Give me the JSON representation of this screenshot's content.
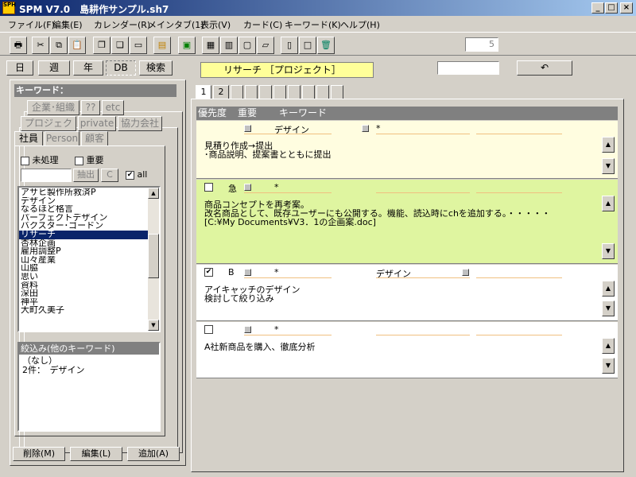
{
  "window": {
    "app_icon_text": "SPH",
    "title": "SPM V7.0　島耕作サンプル.sh7"
  },
  "menu": [
    "ファイル(F)",
    "編集(E)",
    "カレンダー(R)",
    "メインタブ(1)",
    "表示(V)",
    "カード(C)",
    "キーワード(K)",
    "ヘルプ(H)"
  ],
  "toolbar": {
    "counter": "5"
  },
  "view_tabs": [
    "日",
    "週",
    "年",
    "DB",
    "検索"
  ],
  "header": {
    "project_label": "リサーチ ［プロジェクト］",
    "right_input": ""
  },
  "left": {
    "keyword_title": "キーワード：",
    "tabs_row1": [
      "企業･組織",
      "??",
      "etc"
    ],
    "tabs_row2": [
      "プロジェクト",
      "private",
      "協力会社"
    ],
    "tabs_row3": [
      "社員",
      "Person",
      "顧客"
    ],
    "chk_unprocessed": "未処理",
    "chk_important": "重要",
    "extract_btn": "抽出",
    "c_btn": "C",
    "all_label": "all",
    "keywords": [
      "アサヒ製作所救済P",
      "デザイン",
      "なるほど格言",
      "パーフェクトデザイン",
      "バクスター･ゴードン",
      "リサーチ",
      "杏林企画",
      "雇用調整P",
      "山々産業",
      "山脇",
      "思い",
      "資料",
      "深田",
      "神平",
      "大町久美子"
    ],
    "selected_keyword": "リサーチ",
    "filter_title": "絞込み(他のキーワード)",
    "filter_items": [
      "（なし）",
      "2件：　デザイン"
    ],
    "btn_delete": "削除(M)",
    "btn_edit": "編集(L)",
    "btn_add": "追加(A)"
  },
  "page_tabs": [
    "1",
    "2"
  ],
  "list_header": {
    "priority": "優先度",
    "importance": "重要",
    "keyword": "キーワード"
  },
  "cards": [
    {
      "bg": "#fffde0",
      "checked": false,
      "priority": "",
      "kw1": "デザイン",
      "kw2": "*",
      "text": "見積り作成→提出\n･商品説明、提案書とともに提出"
    },
    {
      "bg": "#dff5a0",
      "checked": false,
      "priority": "急",
      "kw1": "*",
      "kw2": "",
      "text": "商品コンセプトを再考案。\n改名商品として、既存ユーザーにも公開する。機能、読込時にchを追加する。・・・・・\n[C:¥My Documents¥V3．1の企画案.doc]"
    },
    {
      "bg": "#ffffff",
      "checked": true,
      "priority": "B",
      "kw1": "*",
      "kw2": "デザイン",
      "text": "アイキャッチのデザイン\n検討して絞り込み"
    },
    {
      "bg": "#ffffff",
      "checked": false,
      "priority": "",
      "kw1": "*",
      "kw2": "",
      "text": "A社新商品を購入、徹底分析"
    }
  ]
}
